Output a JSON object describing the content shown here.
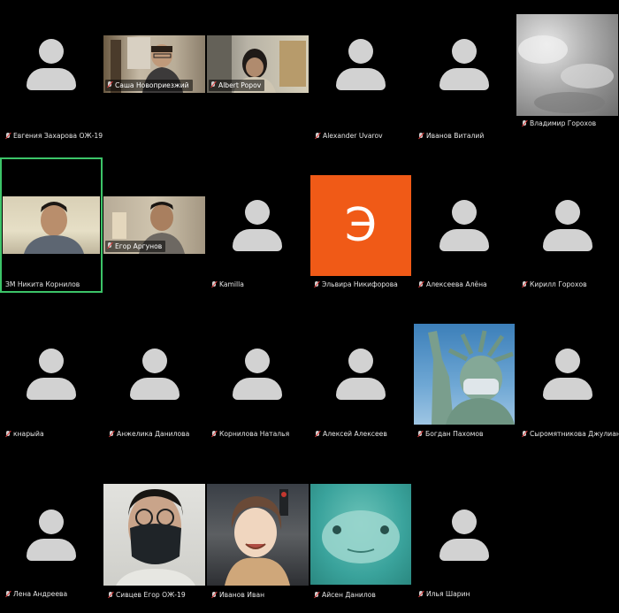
{
  "participants": [
    {
      "name": "Евгения Захарова ОЖ-19"
    },
    {
      "name": "Саша Новоприезжий"
    },
    {
      "name": "Albert Popov"
    },
    {
      "name": "Alexander Uvarov"
    },
    {
      "name": "Иванов Виталий"
    },
    {
      "name": "Владимир Горохов"
    },
    {
      "name": "ЗМ Никита Корнилов"
    },
    {
      "name": "Егор Аргунов"
    },
    {
      "name": "Kamilla"
    },
    {
      "name": "Эльвира Никифорова",
      "initial": "Э",
      "color": "#f05a17"
    },
    {
      "name": "Алексеева Алёна"
    },
    {
      "name": "Кирилл Горохов"
    },
    {
      "name": "кнарыйа"
    },
    {
      "name": "Анжелика Данилова"
    },
    {
      "name": "Корнилова Наталья"
    },
    {
      "name": "Алексей Алексеев"
    },
    {
      "name": "Богдан Пахомов"
    },
    {
      "name": "Сыромятникова Джулиана"
    },
    {
      "name": "Лена Андреева"
    },
    {
      "name": "Сивцев Егор ОЖ-19"
    },
    {
      "name": "Иванов Иван"
    },
    {
      "name": "Айсен Данилов"
    },
    {
      "name": "Илья Шарин"
    }
  ],
  "colors": {
    "background": "#000000",
    "active_speaker_border": "#3cc468",
    "avatar": "#d2d2d2",
    "muted_mic": "#e03b3b"
  },
  "icons": {
    "muted": "muted-mic-icon",
    "avatar": "user-silhouette-icon"
  }
}
